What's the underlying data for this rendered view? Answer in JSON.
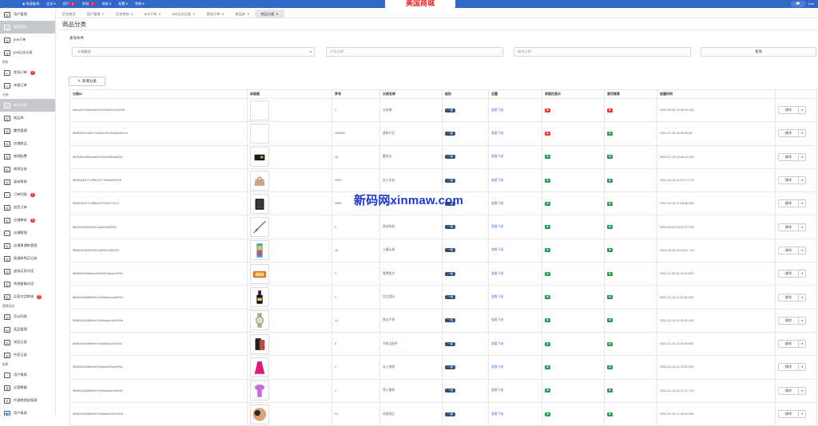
{
  "topbar": {
    "nav": [
      {
        "label": "◆ 快速查询",
        "badge": ""
      },
      {
        "label": "会员 ▾",
        "badge": ""
      },
      {
        "label": "用户",
        "badge": "5"
      },
      {
        "label": "财务",
        "badge": "0"
      },
      {
        "label": "商务 ▾",
        "badge": ""
      },
      {
        "label": "配置 ▾",
        "badge": ""
      },
      {
        "label": "系统 ▾",
        "badge": ""
      }
    ],
    "brand": "美国商城",
    "chat_icon": "chat-icon",
    "user": "root"
  },
  "sidebar": [
    {
      "type": "item",
      "label": "用户管理",
      "icon": "table-icon"
    },
    {
      "type": "item",
      "label": "角色授权",
      "icon": "table-icon",
      "active": true
    },
    {
      "type": "item",
      "label": "pos下单",
      "icon": "table-icon"
    },
    {
      "type": "item",
      "label": "pos日志记录",
      "icon": "table-icon"
    },
    {
      "type": "cat",
      "label": "财务"
    },
    {
      "type": "item",
      "label": "提现订单",
      "icon": "card-icon",
      "badge": "0"
    },
    {
      "type": "item",
      "label": "充值订单",
      "icon": "card-icon"
    },
    {
      "type": "cat",
      "label": "业务"
    },
    {
      "type": "item",
      "label": "商品分类",
      "icon": "table-icon",
      "active": true
    },
    {
      "type": "item",
      "label": "商品库",
      "icon": "table-icon"
    },
    {
      "type": "item",
      "label": "属性管理",
      "icon": "table-icon"
    },
    {
      "type": "item",
      "label": "店铺商品",
      "icon": "table-icon"
    },
    {
      "type": "item",
      "label": "借贷配置",
      "icon": "table-icon"
    },
    {
      "type": "item",
      "label": "借贷记录",
      "icon": "table-icon"
    },
    {
      "type": "item",
      "label": "真有帮助",
      "icon": "table-icon"
    },
    {
      "type": "item",
      "label": "订单列表",
      "icon": "card-icon",
      "badge": "1"
    },
    {
      "type": "item",
      "label": "退货订单",
      "icon": "table-icon"
    },
    {
      "type": "item",
      "label": "店铺审核",
      "icon": "table-icon",
      "badge": "5"
    },
    {
      "type": "item",
      "label": "店铺管理",
      "icon": "card-icon"
    },
    {
      "type": "item",
      "label": "店铺直通车管理",
      "icon": "table-icon"
    },
    {
      "type": "item",
      "label": "直通车购买记录",
      "icon": "table-icon"
    },
    {
      "type": "item",
      "label": "虚拟买家对话",
      "icon": "table-icon"
    },
    {
      "type": "item",
      "label": "系统客服对话",
      "icon": "table-icon"
    },
    {
      "type": "item",
      "label": "买家对话审核",
      "icon": "table-icon",
      "badge": "1"
    },
    {
      "type": "cat",
      "label": "营销活动"
    },
    {
      "type": "item",
      "label": "活动列表",
      "icon": "table-icon"
    },
    {
      "type": "item",
      "label": "奖品管理",
      "icon": "table-icon"
    },
    {
      "type": "item",
      "label": "领奖记录",
      "icon": "table-icon"
    },
    {
      "type": "item",
      "label": "中奖记录",
      "icon": "table-icon"
    },
    {
      "type": "cat",
      "label": "报表"
    },
    {
      "type": "item",
      "label": "用户报表",
      "icon": "pie-icon"
    },
    {
      "type": "item",
      "label": "运营数据",
      "icon": "bar-icon"
    },
    {
      "type": "item",
      "label": "代理商佣金报表",
      "icon": "org-icon"
    },
    {
      "type": "item",
      "label": "用户报表",
      "icon": "people-icon"
    }
  ],
  "tabs": [
    {
      "label": "后台首页",
      "active": false,
      "closable": false
    },
    {
      "label": "用户管理",
      "active": false,
      "closable": true
    },
    {
      "label": "后台审核",
      "active": false,
      "closable": true
    },
    {
      "label": "pos下单",
      "active": false,
      "closable": true
    },
    {
      "label": "pos日志记录",
      "active": false,
      "closable": true
    },
    {
      "label": "提现订单",
      "active": false,
      "closable": true
    },
    {
      "label": "商品库",
      "active": false,
      "closable": true
    },
    {
      "label": "商品分类",
      "active": true,
      "closable": true
    }
  ],
  "page_title": "商品分类",
  "query": {
    "title": "查询条件",
    "select_value": "分类级别",
    "start_placeholder": "开始日期",
    "end_placeholder": "结束日期",
    "button": "查询"
  },
  "add_button": "新增分类",
  "table": {
    "headers": [
      "分类ID",
      "封面图",
      "序号",
      "分类名称",
      "级别",
      "设置",
      "导航栏显示",
      "首页推荐",
      "创建时间",
      ""
    ],
    "level_label": "一级",
    "setting_label": "查看下级",
    "op_label": "操作",
    "rows": [
      {
        "id": "0fdca53298bea40301992a0b10c6009f",
        "img": "none",
        "seq": "1",
        "name": "垃圾桶",
        "nav": "red",
        "home": "red",
        "time": "2025-09-08 23:06:32.326"
      },
      {
        "id": "ff8080819196c77a3d0190c304a5d40113",
        "img": "none",
        "seq": "168899",
        "name": "虚拟产品",
        "nav": "red",
        "home": "green",
        "time": "2024-07-16 06:30:25.86"
      },
      {
        "id": "8b3458c58f6cdaf20189bcd80da6000",
        "img": "wallet",
        "seq": "18",
        "name": "奢侈品",
        "nav": "green",
        "home": "green",
        "time": "2023-07-19 14:48:14.406"
      },
      {
        "id": "ff808081877c3f5f01877ff4b8d6001b",
        "img": "bag",
        "seq": "9999",
        "name": "女士包包",
        "nav": "green",
        "home": "green",
        "time": "2023-04-14 21:29:17.275"
      },
      {
        "id": "ff808081877c3f5f01877ff44270017",
        "img": "wallet2",
        "seq": "9999",
        "name": "男士包包",
        "nav": "green",
        "home": "green",
        "time": "2023-04-14 21:28:46.063"
      },
      {
        "id": "ff808081860b0f0018a0108f0000",
        "img": "rod",
        "seq": "4",
        "name": "休闲饰具",
        "nav": "green",
        "home": "green",
        "time": "2023-03-04 04:10:37.228"
      },
      {
        "id": "ff808081860f2056186f0fb1000005",
        "img": "toy",
        "seq": "15",
        "name": "儿童玩具",
        "nav": "green",
        "home": "green",
        "time": "2023-02-20 23:09:51.749"
      },
      {
        "id": "ff808081846e9ecf0184bf7a6ae20002",
        "img": "food",
        "seq": "3",
        "name": "零食甜点",
        "nav": "green",
        "home": "green",
        "time": "2022-11-29 02:23:01.837"
      },
      {
        "id": "ff8080818488f9ef01848ab0d4a30010",
        "img": "wine",
        "seq": "0",
        "name": "饮品酒水",
        "nav": "green",
        "home": "green",
        "time": "2022-11-16 21:40:02.339"
      },
      {
        "id": "ff8080818488f9ef01848dadc1b0000e",
        "img": "watch",
        "seq": "14",
        "name": "珠宝手表",
        "nav": "green",
        "home": "green",
        "time": "2022-11-16 21:39:41.103"
      },
      {
        "id": "ff8080818488f9ef01848dafecd0000c",
        "img": "phone",
        "seq": "5",
        "name": "手机及配件",
        "nav": "green",
        "home": "green",
        "time": "2022-11-16 21:38:00.592"
      },
      {
        "id": "ff8080818488f9ef01848da9f3ea000a",
        "img": "dress",
        "seq": "2",
        "name": "女士服装",
        "nav": "green",
        "home": "green",
        "time": "2022-11-16 21:37:51.594"
      },
      {
        "id": "ff8080818488f9ef01848dada0ef0008",
        "img": "shirt",
        "seq": "1",
        "name": "男士服装",
        "nav": "green",
        "home": "green",
        "time": "2022-11-16 21:37:27.791"
      },
      {
        "id": "ff8080818488f9ef01848dad25c10006",
        "img": "baby",
        "seq": "13",
        "name": "母婴用品",
        "nav": "green",
        "home": "green",
        "time": "2022-11-16 21:36:54.209"
      }
    ]
  },
  "watermark": "新码网xinmaw.com",
  "colors": {
    "topbar": "#3167c9",
    "brand": "#e8252e",
    "pill": "#2e4d74",
    "link": "#3a7bd5",
    "red": "#e53935",
    "green": "#2e9b55",
    "active_side": "#c5c8cc"
  }
}
